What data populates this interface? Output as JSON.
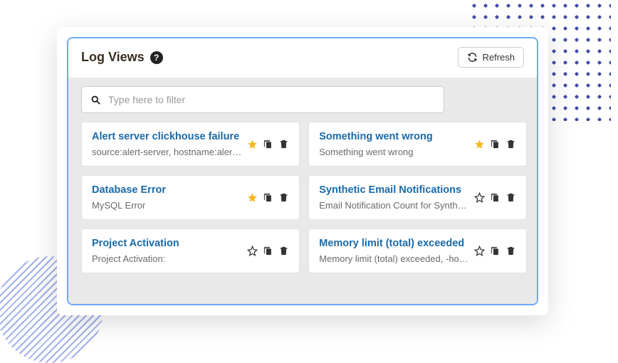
{
  "header": {
    "title": "Log Views",
    "help_symbol": "?",
    "refresh_label": "Refresh"
  },
  "filter": {
    "placeholder": "Type here to filter"
  },
  "cards": [
    {
      "title": "Alert server clickhouse failure",
      "desc": "source:alert-server, hostname:aler…",
      "starred": true
    },
    {
      "title": "Something went wrong",
      "desc": "Something went wrong",
      "starred": true
    },
    {
      "title": "Database Error",
      "desc": "MySQL Error",
      "starred": true
    },
    {
      "title": "Synthetic Email Notifications",
      "desc": "Email Notification Count for Synth…",
      "starred": false
    },
    {
      "title": "Project Activation",
      "desc": "Project Activation:",
      "starred": false
    },
    {
      "title": "Memory limit (total) exceeded",
      "desc": "Memory limit (total) exceeded, -ho…",
      "starred": false
    }
  ]
}
